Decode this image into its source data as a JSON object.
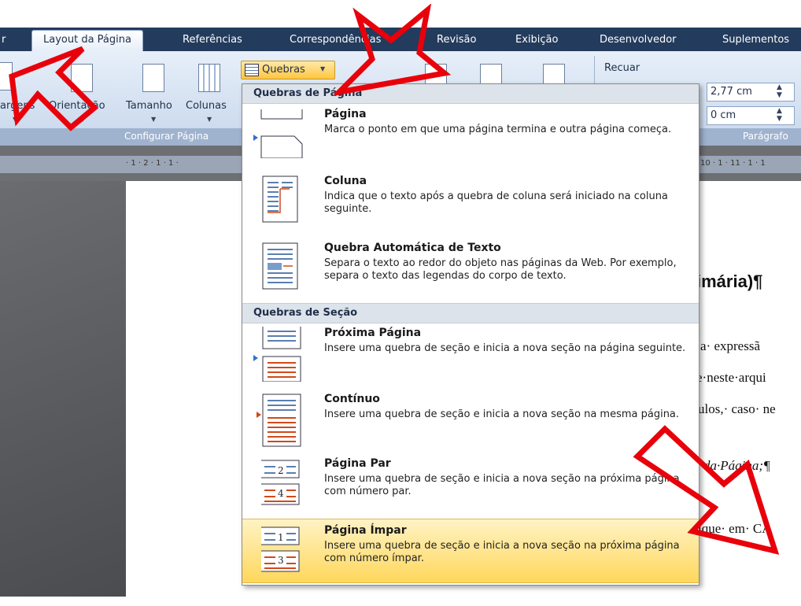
{
  "tabs": [
    "Layout da Página",
    "Referências",
    "Correspondências",
    "Revisão",
    "Exibição",
    "Desenvolvedor",
    "Suplementos"
  ],
  "partial_tab": "r",
  "ribbon": {
    "margins_label": "argens",
    "orientation_label": "Orientação",
    "size_label": "Tamanho",
    "columns_label": "Colunas",
    "breaks_label": "Quebras",
    "indent_label": "Recuar",
    "indent_left": "2,77 cm",
    "indent_right": "0 cm",
    "group_page_setup": "Configurar Página",
    "group_paragraph": "Parágrafo"
  },
  "ruler_left": "· 1 · 2 · 1 · 1 ·",
  "ruler_right": "10 · 1 · 11 · 1 · 1",
  "document": {
    "heading": "imária)¶",
    "line1": "a· expressã",
    "line2": "e·neste·arqui",
    "line3": "ulos,· caso· ne",
    "line4": "t·da·Página;¶",
    "line5": "ique· em· CA"
  },
  "menu": {
    "section_page": "Quebras de Página",
    "section_section": "Quebras de Seção",
    "items": [
      {
        "title": "Página",
        "desc": "Marca o ponto em que uma página termina e outra página começa."
      },
      {
        "title": "Coluna",
        "desc": "Indica que o texto após a quebra de coluna será iniciado na coluna seguinte."
      },
      {
        "title": "Quebra Automática de Texto",
        "desc": "Separa o texto ao redor do objeto nas páginas da Web. Por exemplo, separa o texto das legendas do corpo de texto."
      },
      {
        "title": "Próxima Página",
        "desc": "Insere uma quebra de seção e inicia a nova seção na página seguinte."
      },
      {
        "title": "Contínuo",
        "desc": "Insere uma quebra de seção e inicia a nova seção na mesma página."
      },
      {
        "title": "Página Par",
        "desc": "Insere uma quebra de seção e inicia a nova seção na próxima página com número par."
      },
      {
        "title": "Página Ímpar",
        "desc": "Insere uma quebra de seção e inicia a nova seção na próxima página com número ímpar."
      }
    ],
    "icon_nums": {
      "par_top": "2",
      "par_bottom": "4",
      "impar_top": "1",
      "impar_bottom": "3"
    }
  },
  "colors": {
    "accent_red": "#e8000b",
    "highlight": "#ffd75c",
    "tabbar": "#233b5c"
  }
}
